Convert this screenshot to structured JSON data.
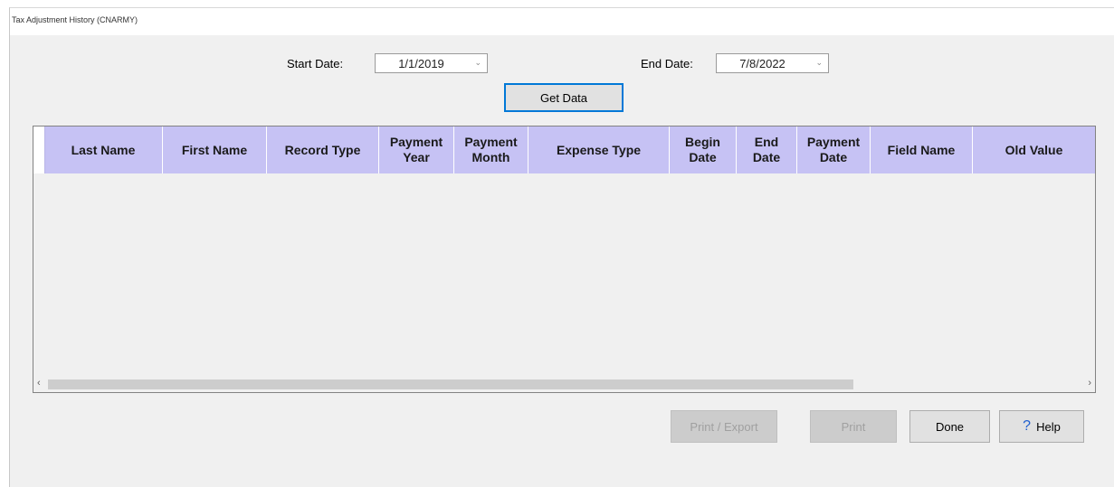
{
  "window": {
    "title": "Tax Adjustment History (CNARMY)"
  },
  "filters": {
    "start_label": "Start Date:",
    "start_value": "1/1/2019",
    "end_label": "End Date:",
    "end_value": "7/8/2022",
    "get_data_label": "Get Data"
  },
  "table": {
    "columns": [
      "Last Name",
      "First Name",
      "Record Type",
      "Payment\nYear",
      "Payment\nMonth",
      "Expense Type",
      "Begin\nDate",
      "End\nDate",
      "Payment\nDate",
      "Field Name",
      "Old Value"
    ],
    "rows": [],
    "header_color": "#c6c2f4"
  },
  "footer": {
    "print_export_label": "Print / Export",
    "print_label": "Print",
    "done_label": "Done",
    "help_label": "Help"
  },
  "icons": {
    "dropdown": "chevron-down-icon",
    "help": "question-mark-icon",
    "scroll_left": "chevron-left-icon",
    "scroll_right": "chevron-right-icon"
  }
}
